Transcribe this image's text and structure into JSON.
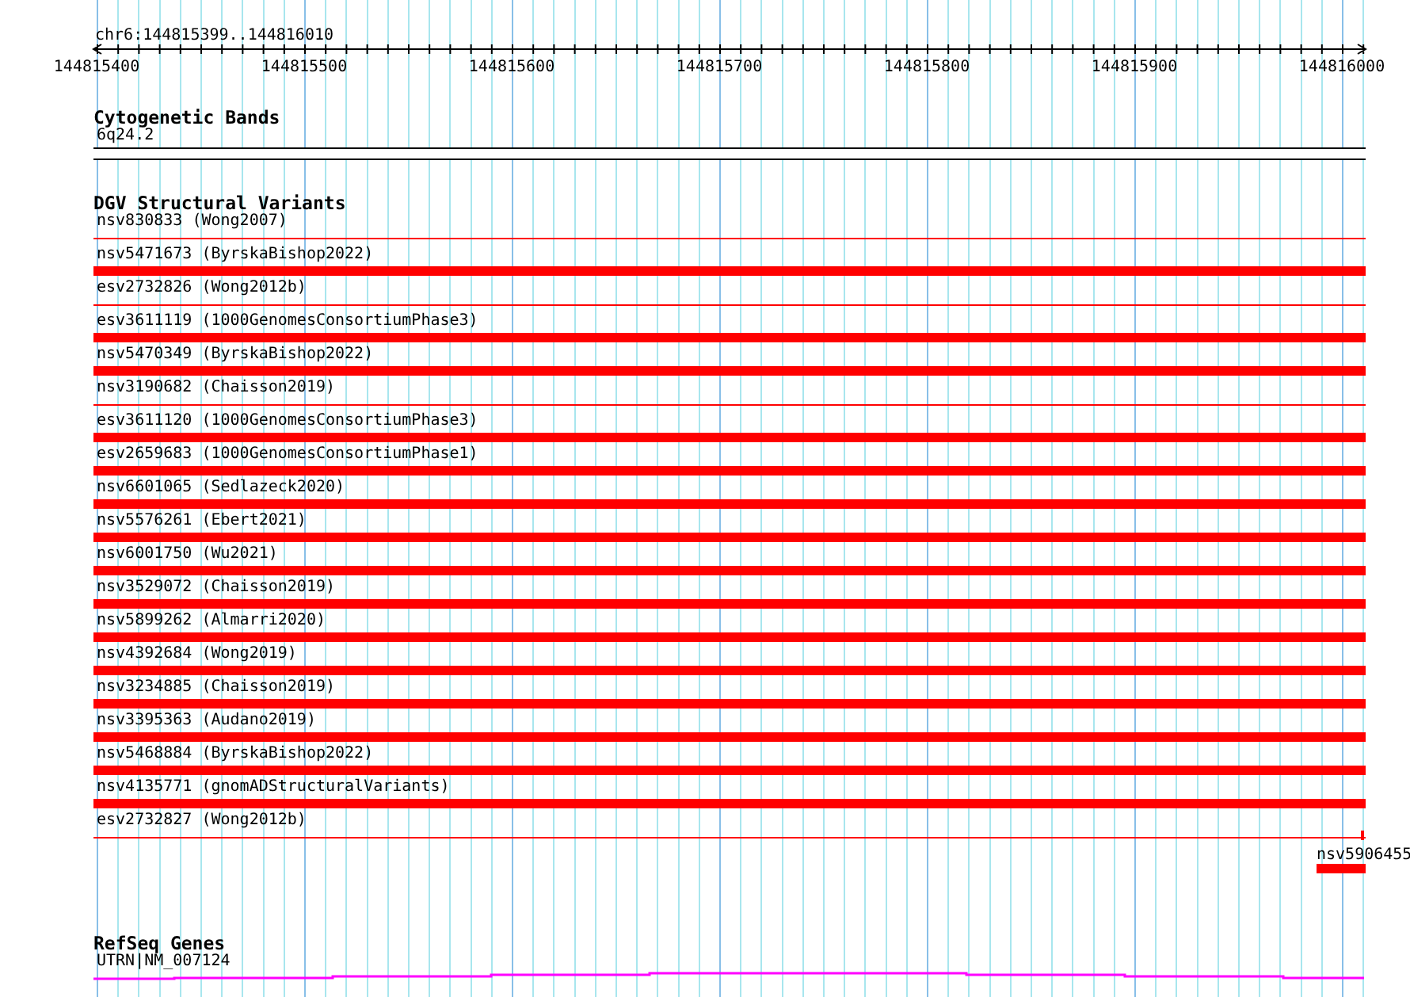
{
  "ruler": {
    "region": "chr6:144815399..144816010",
    "ticks": [
      "144815400",
      "144815500",
      "144815600",
      "144815700",
      "144815800",
      "144815900",
      "144816000"
    ]
  },
  "tracks": [
    {
      "kind": "bands",
      "title": "Cytogenetic Bands",
      "features": [
        {
          "label": "6q24.2"
        }
      ]
    },
    {
      "kind": "variants",
      "title": "DGV Structural Variants",
      "features": [
        {
          "label": "nsv830833 (Wong2007)",
          "kind": "line"
        },
        {
          "label": "nsv5471673 (ByrskaBishop2022)",
          "kind": "bar"
        },
        {
          "label": "esv2732826 (Wong2012b)",
          "kind": "line"
        },
        {
          "label": "esv3611119 (1000GenomesConsortiumPhase3)",
          "kind": "bar"
        },
        {
          "label": "nsv5470349 (ByrskaBishop2022)",
          "kind": "bar"
        },
        {
          "label": "nsv3190682 (Chaisson2019)",
          "kind": "line"
        },
        {
          "label": "esv3611120 (1000GenomesConsortiumPhase3)",
          "kind": "bar"
        },
        {
          "label": "esv2659683 (1000GenomesConsortiumPhase1)",
          "kind": "bar"
        },
        {
          "label": "nsv6601065 (Sedlazeck2020)",
          "kind": "bar"
        },
        {
          "label": "nsv5576261 (Ebert2021)",
          "kind": "bar"
        },
        {
          "label": "nsv6001750 (Wu2021)",
          "kind": "bar"
        },
        {
          "label": "nsv3529072 (Chaisson2019)",
          "kind": "bar"
        },
        {
          "label": "nsv5899262 (Almarri2020)",
          "kind": "bar"
        },
        {
          "label": "nsv4392684 (Wong2019)",
          "kind": "bar"
        },
        {
          "label": "nsv3234885 (Chaisson2019)",
          "kind": "bar"
        },
        {
          "label": "nsv3395363 (Audano2019)",
          "kind": "bar"
        },
        {
          "label": "nsv5468884 (ByrskaBishop2022)",
          "kind": "bar"
        },
        {
          "label": "nsv4135771 (gnomADStructuralVariants)",
          "kind": "bar"
        },
        {
          "label": "esv2732827 (Wong2012b)",
          "kind": "tick"
        },
        {
          "label": "nsv5906455",
          "kind": "short"
        }
      ]
    },
    {
      "kind": "genes",
      "title": "RefSeq Genes",
      "features": [
        {
          "label": "UTRN|NM_007124"
        }
      ]
    }
  ]
}
